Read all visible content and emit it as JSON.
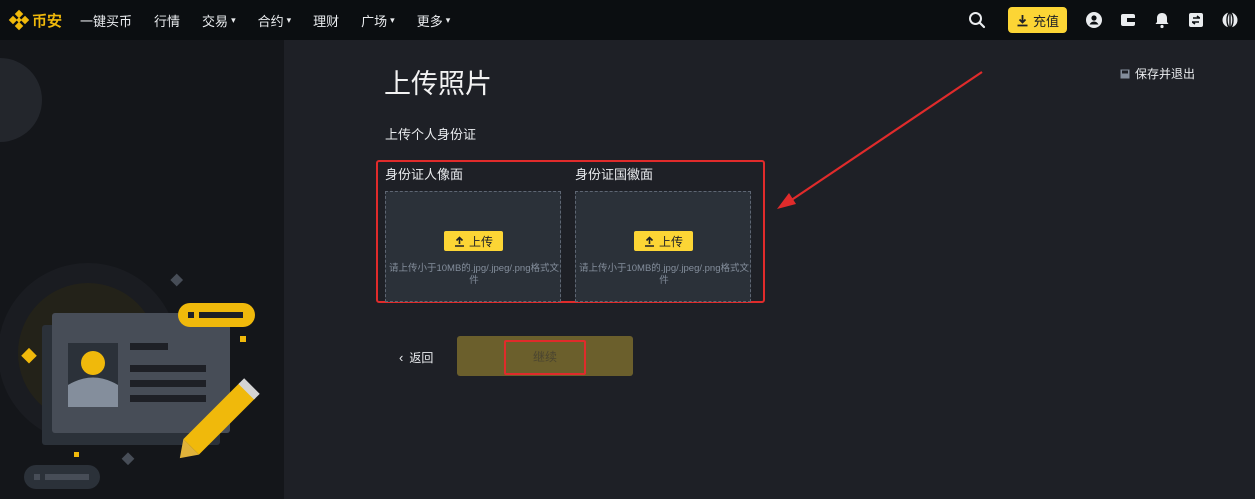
{
  "header": {
    "logo_text": "币安",
    "nav": [
      {
        "label": "一键买币",
        "dropdown": false
      },
      {
        "label": "行情",
        "dropdown": false
      },
      {
        "label": "交易",
        "dropdown": true
      },
      {
        "label": "合约",
        "dropdown": true
      },
      {
        "label": "理财",
        "dropdown": false
      },
      {
        "label": "广场",
        "dropdown": true
      },
      {
        "label": "更多",
        "dropdown": true
      }
    ],
    "deposit_label": "充值",
    "icons": [
      "search-icon",
      "download-icon",
      "user-icon",
      "wallet-icon",
      "bell-icon",
      "transfer-icon",
      "globe-icon"
    ]
  },
  "main": {
    "title": "上传照片",
    "save_exit": "保存并退出",
    "section_title": "上传个人身份证",
    "cards": [
      {
        "label": "身份证人像面",
        "button": "上传",
        "hint": "请上传小于10MB的.jpg/.jpeg/.png格式文件"
      },
      {
        "label": "身份证国徽面",
        "button": "上传",
        "hint": "请上传小于10MB的.jpg/.jpeg/.png格式文件"
      }
    ],
    "back_label": "返回",
    "continue_label": "继续"
  },
  "colors": {
    "brand": "#f0b90b",
    "button": "#fcd535",
    "annotation": "#e02b2b",
    "page_bg": "#1e2026",
    "topbar_bg": "#0b0e11"
  }
}
